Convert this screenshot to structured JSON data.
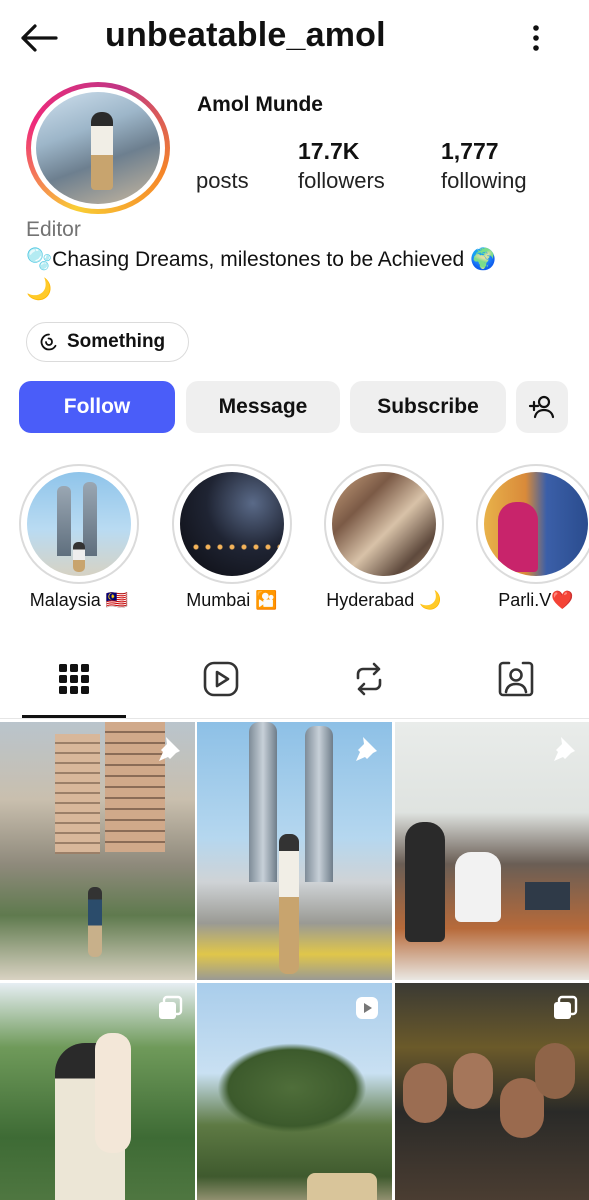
{
  "header": {
    "username": "unbeatable_amol",
    "back_icon": "arrow-left-icon",
    "menu_icon": "more-vertical-icon"
  },
  "profile": {
    "full_name": "Amol Munde",
    "stats": {
      "posts_count": "",
      "posts_label": "posts",
      "followers_count": "17.7K",
      "followers_label": "followers",
      "following_count": "1,777",
      "following_label": "following"
    },
    "category": "Editor",
    "bio_line1": "🫧Chasing Dreams, milestones to be Achieved 🌍",
    "bio_line2": "🌙",
    "threads_chip": "Something"
  },
  "actions": {
    "follow": "Follow",
    "message": "Message",
    "subscribe": "Subscribe",
    "add_user_icon": "add-person-icon"
  },
  "highlights": [
    {
      "label": "Malaysia 🇲🇾"
    },
    {
      "label": "Mumbai 🎦"
    },
    {
      "label": "Hyderabad 🌙"
    },
    {
      "label": "Parli.V❤️"
    }
  ],
  "tabs": [
    {
      "name": "grid",
      "icon": "grid-icon",
      "active": true
    },
    {
      "name": "reels",
      "icon": "reels-icon",
      "active": false
    },
    {
      "name": "reposts",
      "icon": "repost-icon",
      "active": false
    },
    {
      "name": "tagged",
      "icon": "tagged-person-icon",
      "active": false
    }
  ],
  "posts": [
    {
      "badge": "pin-icon"
    },
    {
      "badge": "pin-icon"
    },
    {
      "badge": "pin-icon"
    },
    {
      "badge": "carousel-icon"
    },
    {
      "badge": "reel-icon"
    },
    {
      "badge": "carousel-icon"
    }
  ],
  "colors": {
    "follow_button": "#4a5df9",
    "secondary_button": "#efefef",
    "muted_text": "#737373"
  }
}
